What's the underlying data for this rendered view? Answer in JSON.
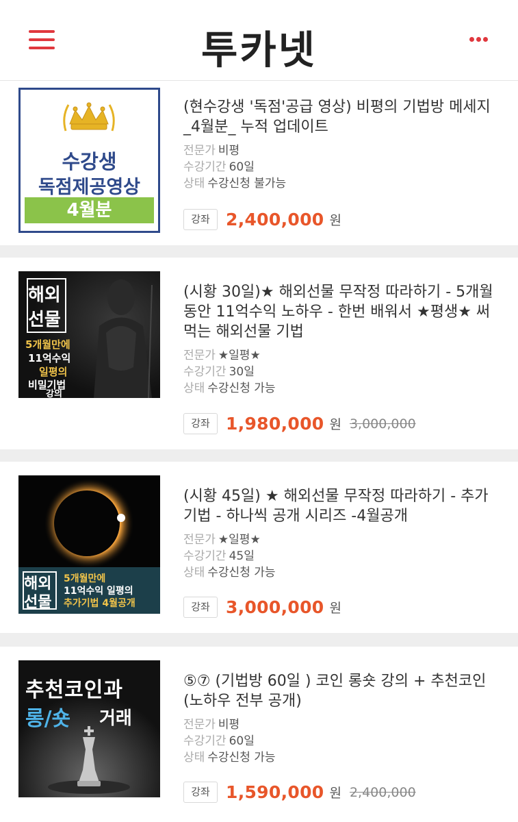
{
  "header": {
    "logo": "투카넷",
    "menu_icon": "hamburger-menu-icon",
    "more_icon": "more-dots-icon"
  },
  "colors": {
    "accent": "#e0383e",
    "price": "#e8562a"
  },
  "labels": {
    "expert": "전문가",
    "period": "수강기간",
    "status": "상태",
    "tag": "강좌",
    "won": "원"
  },
  "courses": [
    {
      "title": "(현수강생 '독점'공급 영상) 비평의 기법방 메세지 _4월분_ 누적 업데이트",
      "expert": "비평",
      "period": "60일",
      "status": "수강신청 불가능",
      "price": "2,400,000",
      "original_price": "",
      "thumb": {
        "line1": "수강생",
        "line2": "독점제공영상",
        "line3": "4월분"
      }
    },
    {
      "title": "(시황 30일)★ 해외선물 무작정 따라하기 - 5개월 동안 11억수익 노하우 - 한번 배워서 ★평생★ 써먹는 해외선물 기법",
      "expert": "★일평★",
      "period": "30일",
      "status": "수강신청 가능",
      "price": "1,980,000",
      "original_price": "3,000,000",
      "thumb": {
        "big1": "해외",
        "big2": "선물",
        "s1": "5개월만에",
        "s2": "11억수익",
        "s3": "일평의",
        "s4": "비밀기법",
        "s5": "강의"
      }
    },
    {
      "title": "(시황 45일) ★ 해외선물 무작정 따라하기 - 추가 기법 - 하나씩 공개 시리즈 -4월공개",
      "expert": "★일평★",
      "period": "45일",
      "status": "수강신청 가능",
      "price": "3,000,000",
      "original_price": "",
      "thumb": {
        "big1": "해외",
        "big2": "선물",
        "s1": "5개월만에",
        "s2": "11억수익 일평의",
        "s3": "추가기법 4월공개"
      }
    },
    {
      "title": "⑤⑦ (기법방 60일 ) 코인 롱숏 강의 + 추천코인 (노하우 전부 공개)",
      "expert": "비평",
      "period": "60일",
      "status": "수강신청 가능",
      "price": "1,590,000",
      "original_price": "2,400,000",
      "thumb": {
        "line1": "추천코인과",
        "line2a": "롱/숏",
        "line2b": "거래"
      }
    }
  ]
}
